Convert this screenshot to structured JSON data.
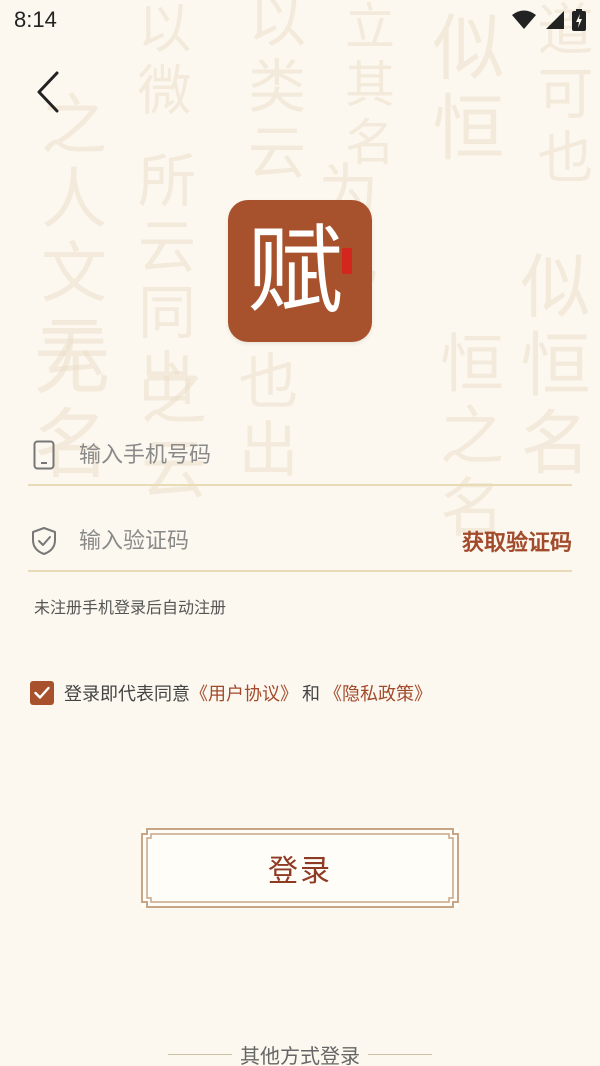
{
  "status_bar": {
    "time": "8:14",
    "icons": [
      "wifi-icon",
      "cell-signal-icon",
      "battery-icon"
    ]
  },
  "nav": {
    "back_icon": "chevron-left-icon"
  },
  "logo": {
    "char": "赋",
    "bg_color": "#a7522c"
  },
  "form": {
    "phone_placeholder": "输入手机号码",
    "phone_value": "",
    "phone_icon": "phone-icon",
    "code_placeholder": "输入验证码",
    "code_value": "",
    "code_icon": "shield-check-icon",
    "get_code_label": "获取验证码",
    "hint": "未注册手机登录后自动注册"
  },
  "agreement": {
    "checked": true,
    "prefix": "登录即代表同意",
    "user_agreement": "《用户协议》",
    "and": "和",
    "privacy_policy": "《隐私政策》"
  },
  "login_button_label": "登录",
  "other_login_label": "其他方式登录",
  "colors": {
    "accent": "#a24a2b",
    "background": "#fcf8ef",
    "divider": "#e8dcb7"
  }
}
